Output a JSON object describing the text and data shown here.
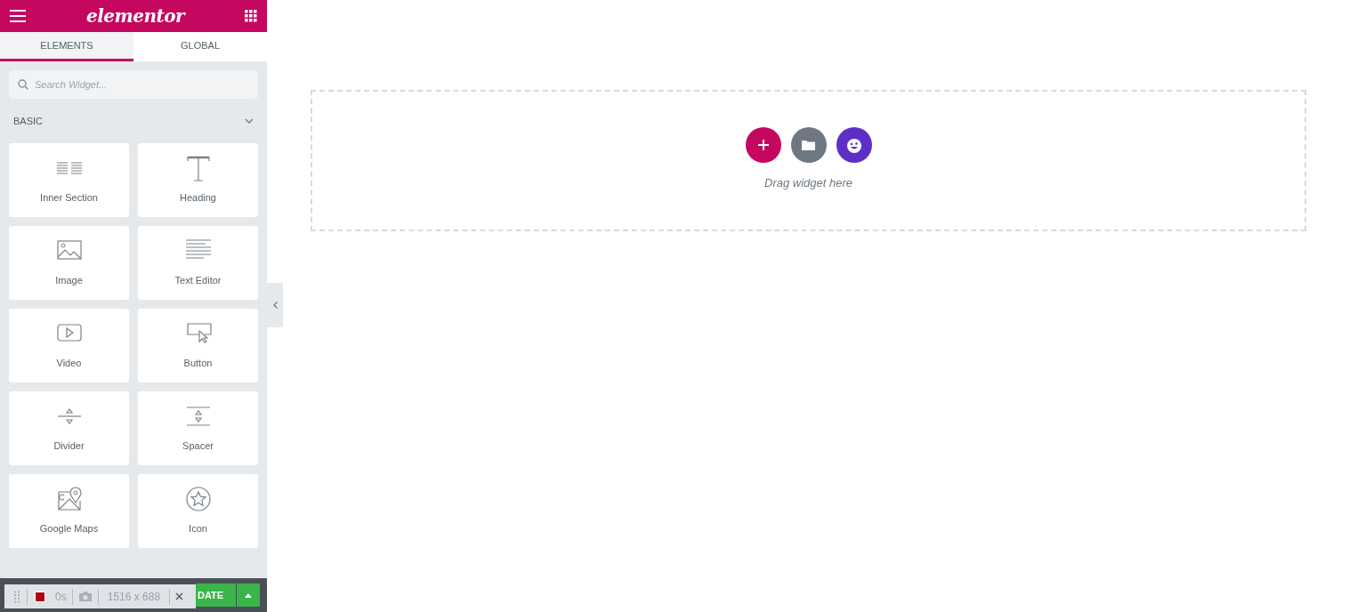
{
  "header": {
    "logo": "elementor"
  },
  "tabs": [
    {
      "label": "ELEMENTS",
      "selected": true
    },
    {
      "label": "GLOBAL",
      "selected": false
    }
  ],
  "search": {
    "placeholder": "Search Widget..."
  },
  "categories": [
    {
      "title": "BASIC",
      "expanded": true,
      "widgets": [
        {
          "label": "Inner Section",
          "kind": "section"
        },
        {
          "label": "Heading",
          "kind": "heading"
        },
        {
          "label": "Image",
          "kind": "image"
        },
        {
          "label": "Text Editor",
          "kind": "text"
        },
        {
          "label": "Video",
          "kind": "video"
        },
        {
          "label": "Button",
          "kind": "button"
        },
        {
          "label": "Divider",
          "kind": "divider"
        },
        {
          "label": "Spacer",
          "kind": "spacer"
        },
        {
          "label": "Google Maps",
          "kind": "map"
        },
        {
          "label": "Icon",
          "kind": "star"
        }
      ]
    }
  ],
  "footer": {
    "update_label": "DATE"
  },
  "recorder": {
    "recording": true,
    "time": "0s",
    "size": "1516 x 688"
  },
  "canvas": {
    "hint": "Drag widget here"
  }
}
